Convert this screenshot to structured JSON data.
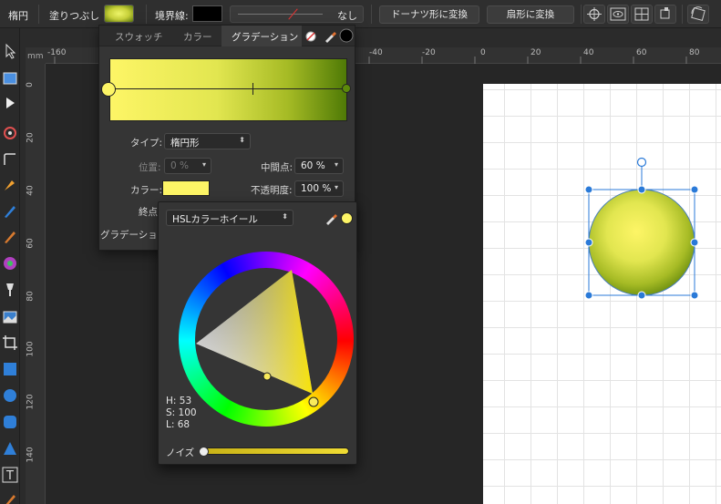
{
  "context_toolbar": {
    "shape_name": "楕円",
    "fill_label": "塗りつぶし",
    "stroke_label": "境界線:",
    "stroke_width_value": "なし",
    "donut_button": "ドーナツ形に変換",
    "pie_button": "扇形に変換"
  },
  "ruler": {
    "unit": "mm",
    "top_ticks": [
      "-160",
      "-40",
      "-20",
      "0",
      "20",
      "40",
      "60",
      "80"
    ],
    "left_ticks": [
      "0",
      "20",
      "40",
      "60",
      "80",
      "100",
      "120",
      "140"
    ]
  },
  "gradient_panel": {
    "tabs": [
      "スウォッチ",
      "カラー",
      "グラデーション"
    ],
    "type_label": "タイプ:",
    "type_value": "楕円形",
    "position_label": "位置:",
    "position_value": "0 %",
    "midpoint_label": "中間点:",
    "midpoint_value": "60 %",
    "color_label": "カラー:",
    "color_value": "#fdf566",
    "opacity_label": "不透明度:",
    "opacity_value": "100 %",
    "endpoint_label": "終点",
    "gradient_label": "グラデーション"
  },
  "color_popup": {
    "mode": "HSLカラーホイール",
    "h": "H: 53",
    "s": "S: 100",
    "l": "L: 68",
    "noise_label": "ノイズ"
  },
  "colors": {
    "gradient_start": "#fdf566",
    "gradient_end": "#4f7a06",
    "selection_handle": "#2a7ad8"
  }
}
